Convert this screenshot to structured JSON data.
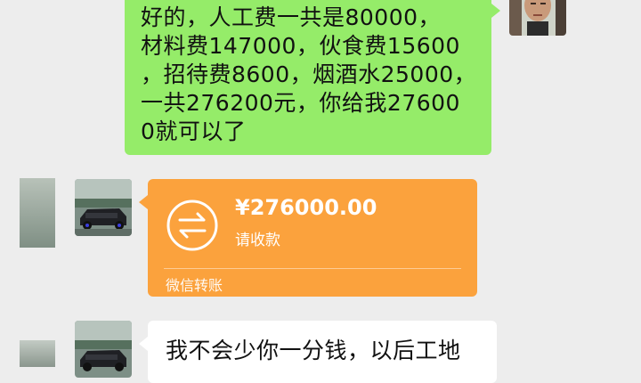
{
  "messages": {
    "outgoing": {
      "lines": [
        "好的，人工费一共是80000，",
        "材料费147000，伙食费15600",
        "，招待费8600，烟酒水25000，",
        "一共276200元，你给我27600",
        "0就可以了"
      ]
    },
    "transfer": {
      "amount": "¥276000.00",
      "status": "请收款",
      "footer": "微信转账",
      "icon": "transfer-arrows-icon"
    },
    "incoming": {
      "text": "我不会少你一分钱，以后工地"
    }
  },
  "colors": {
    "chat_background": "#ededed",
    "outgoing_bubble": "#95ec69",
    "transfer_card": "#fba23d",
    "incoming_bubble": "#ffffff"
  }
}
